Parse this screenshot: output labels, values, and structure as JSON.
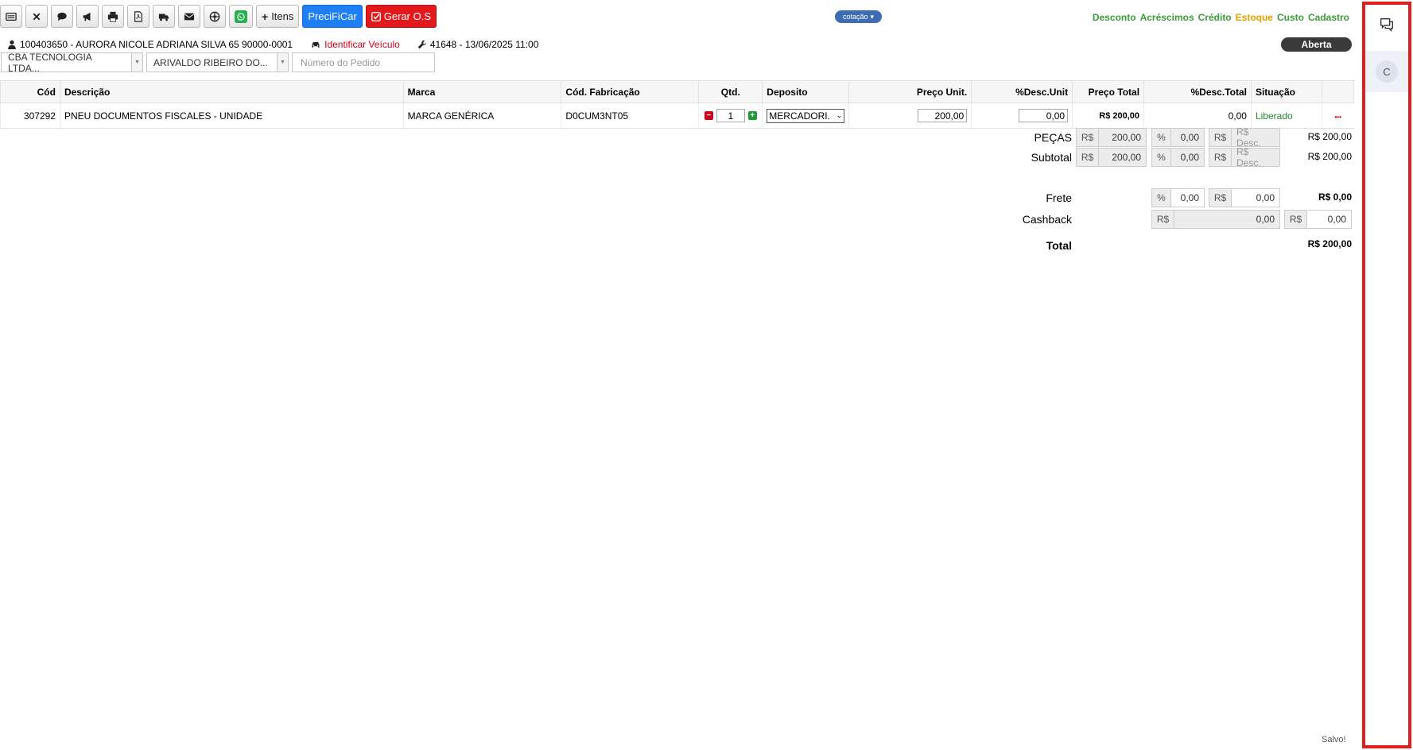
{
  "toolbar": {
    "itens_label": "Itens",
    "precificar_label": "PreciFiCar",
    "gerar_label": "Gerar O.S"
  },
  "cotacao_label": "cotação",
  "toplinks": [
    {
      "label": "Desconto",
      "color": "#3c9b3c"
    },
    {
      "label": "Acréscimos",
      "color": "#3c9b3c"
    },
    {
      "label": "Crédito",
      "color": "#3c9b3c"
    },
    {
      "label": "Estoque",
      "color": "#e8a000"
    },
    {
      "label": "Custo",
      "color": "#3c9b3c"
    },
    {
      "label": "Cadastro",
      "color": "#3c9b3c"
    }
  ],
  "status": "Aberta",
  "info": {
    "client": "100403650 - AURORA NICOLE ADRIANA SILVA 65 90000-0001",
    "vehicle": "Identificar Veículo",
    "order": "41648 - 13/06/2025 11:00"
  },
  "selects": {
    "company": "CBA TECNOLOGIA LTDA...",
    "seller": "ARIVALDO RIBEIRO DO...",
    "pedido_placeholder": "Número do Pedido"
  },
  "table": {
    "headers": {
      "cod": "Cód",
      "descricao": "Descrição",
      "marca": "Marca",
      "cod_fab": "Cód. Fabricação",
      "qtd": "Qtd.",
      "deposito": "Deposito",
      "preco_unit": "Preço Unit.",
      "desc_unit": "%Desc.Unit",
      "preco_total": "Preço Total",
      "desc_total": "%Desc.Total",
      "situacao": "Situação"
    },
    "row": {
      "cod": "307292",
      "descricao": "PNEU DOCUMENTOS FISCALES - UNIDADE",
      "marca": "MARCA GENÉRICA",
      "cod_fab": "D0CUM3NT05",
      "qtd": "1",
      "deposito": "MERCADORI.",
      "preco_unit": "200,00",
      "desc_unit": "0,00",
      "preco_total": "R$ 200,00",
      "desc_total": "0,00",
      "situacao": "Liberado",
      "actions": "•••"
    }
  },
  "summary": {
    "pecas": {
      "label": "PEÇAS",
      "value": "200,00",
      "pct": "0,00",
      "desc_ph": "R$ Desc.",
      "total": "R$ 200,00"
    },
    "subtotal": {
      "label": "Subtotal",
      "value": "200,00",
      "pct": "0,00",
      "desc_ph": "R$ Desc.",
      "total": "R$ 200,00"
    },
    "frete": {
      "label": "Frete",
      "pct": "0,00",
      "value": "0,00",
      "total": "R$ 0,00"
    },
    "cashback": {
      "label": "Cashback",
      "value": "0,00",
      "value2": "0,00"
    },
    "total": {
      "label": "Total",
      "value": "R$ 200,00"
    },
    "rs": "R$",
    "pct_symbol": "%"
  },
  "salvo": "Salvo!",
  "panel": {
    "avatar_letter": "C"
  }
}
